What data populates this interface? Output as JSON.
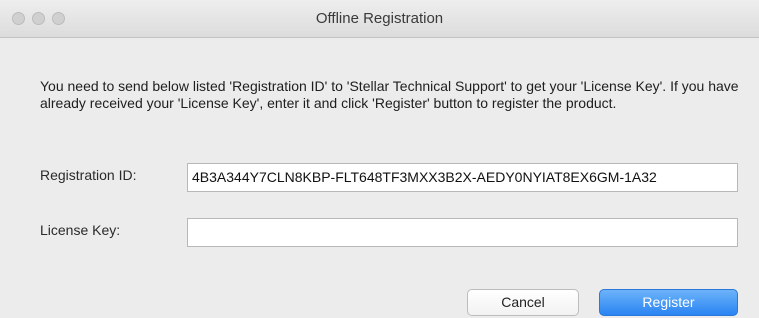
{
  "window": {
    "title": "Offline Registration"
  },
  "instructions": "You need to send below listed 'Registration ID' to 'Stellar Technical Support' to get your 'License Key'. If you have already received your 'License Key', enter it and click 'Register' button to register the product.",
  "registration": {
    "label": "Registration ID:",
    "value": "4B3A344Y7CLN8KBP-FLT648TF3MXX3B2X-AEDY0NYIAT8EX6GM-1A32"
  },
  "license": {
    "label": "License Key:",
    "value": ""
  },
  "buttons": {
    "cancel": "Cancel",
    "register": "Register"
  },
  "colors": {
    "accent": "#2a84f2",
    "window_bg": "#ececec"
  }
}
